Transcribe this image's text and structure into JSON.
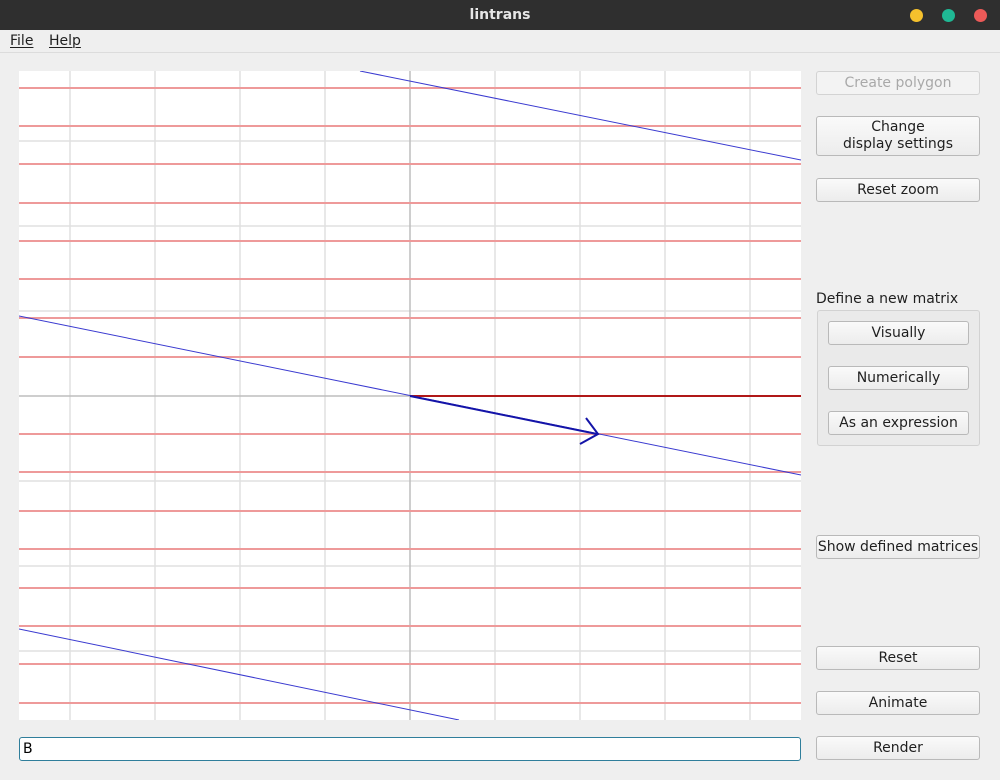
{
  "window": {
    "title": "lintrans"
  },
  "menu": {
    "file": "File",
    "help": "Help"
  },
  "buttons": {
    "create_polygon": "Create polygon",
    "change_display_settings": "Change\ndisplay settings",
    "reset_zoom": "Reset zoom",
    "show_defined_matrices": "Show defined matrices",
    "reset": "Reset",
    "animate": "Animate",
    "render": "Render"
  },
  "define_matrix": {
    "label": "Define a new matrix",
    "visually": "Visually",
    "numerically": "Numerically",
    "as_expression": "As an expression"
  },
  "expression_input": {
    "value": "B"
  },
  "colors": {
    "background_grid": "#e0e0e0",
    "transformed_grid": "#ee9a9a",
    "i_hat": "#b01818",
    "j_hat": "#1414a8",
    "eigenline": "#3a3ad0"
  }
}
